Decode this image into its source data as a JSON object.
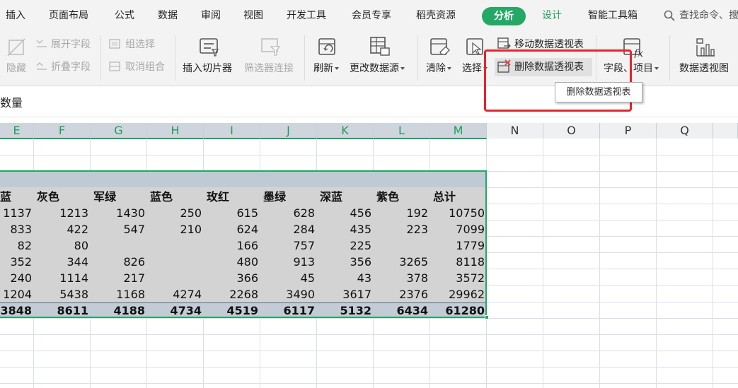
{
  "menubar": {
    "items": [
      "插入",
      "页面布局",
      "公式",
      "数据",
      "审阅",
      "视图",
      "开发工具",
      "会员专享",
      "稻壳资源"
    ],
    "active_tab": "分析",
    "design_tab": "设计",
    "smart_tools": "智能工具箱",
    "search_text": "查找命令、搜",
    "accent_color": "#23a865"
  },
  "ribbon": {
    "hide": "隐藏",
    "expand_field": "展开字段",
    "collapse_field": "折叠字段",
    "group_selection": "组选择",
    "ungroup": "取消组合",
    "insert_slicer": "插入切片器",
    "filter_connection": "筛选器连接",
    "refresh": "刷新",
    "change_source": "更改数据源",
    "clear": "清除",
    "select": "选择",
    "move_pivot": "移动数据透视表",
    "delete_pivot": "删除数据透视表",
    "fields_items": "字段、项目",
    "pivot_chart": "数据透视图"
  },
  "tooltip": {
    "text": "删除数据透视表"
  },
  "formula_bar": {
    "content": "数量"
  },
  "columns": [
    "E",
    "F",
    "G",
    "H",
    "I",
    "J",
    "K",
    "L",
    "M",
    "N",
    "O",
    "P",
    "Q"
  ],
  "pivot": {
    "headers": [
      "蓝",
      "灰色",
      "军绿",
      "蓝色",
      "玫红",
      "墨绿",
      "深蓝",
      "紫色",
      "总计"
    ],
    "rows": [
      [
        "1137",
        "1213",
        "1430",
        "250",
        "615",
        "628",
        "456",
        "192",
        "10750"
      ],
      [
        "833",
        "422",
        "547",
        "210",
        "624",
        "284",
        "435",
        "223",
        "7099"
      ],
      [
        "82",
        "80",
        "",
        "",
        "166",
        "757",
        "225",
        "",
        "1779"
      ],
      [
        "352",
        "344",
        "826",
        "",
        "480",
        "913",
        "356",
        "3265",
        "8118"
      ],
      [
        "240",
        "1114",
        "217",
        "",
        "366",
        "45",
        "43",
        "378",
        "3572"
      ],
      [
        "1204",
        "5438",
        "1168",
        "4274",
        "2268",
        "3490",
        "3617",
        "2376",
        "29962"
      ]
    ],
    "totals": [
      "3848",
      "8611",
      "4188",
      "4734",
      "4519",
      "6117",
      "5132",
      "6434",
      "61280"
    ]
  }
}
